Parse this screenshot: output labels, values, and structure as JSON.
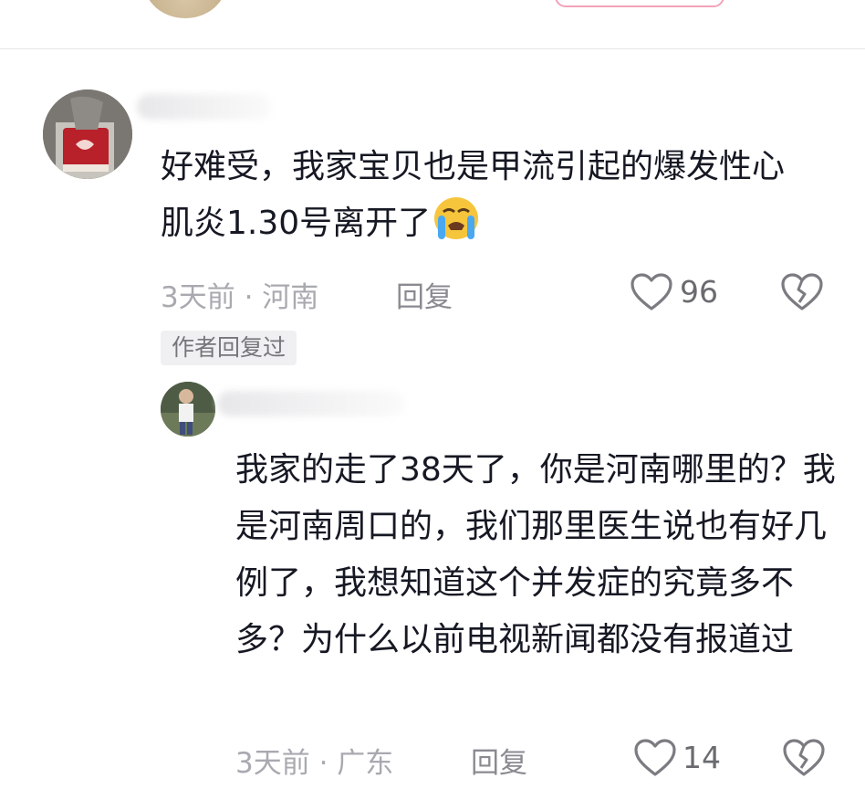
{
  "comment": {
    "text": "好难受，我家宝贝也是甲流引起的爆发性心肌炎1.30号离开了",
    "emoji": "crying-face-emoji",
    "time": "3天前",
    "location": "河南",
    "reply_label": "回复",
    "likes": "96",
    "author_tag": "作者回复过"
  },
  "reply": {
    "text": "我家的走了38天了，你是河南哪里的？我是河南周口的，我们那里医生说也有好几例了，我想知道这个并发症的究竟多不多？为什么以前电视新闻都没有报道过",
    "time": "3天前",
    "location": "广东",
    "reply_label": "回复",
    "likes": "14"
  },
  "colors": {
    "text": "#161823",
    "meta": "#a9aab0",
    "tag_bg": "#f0f0f2"
  }
}
